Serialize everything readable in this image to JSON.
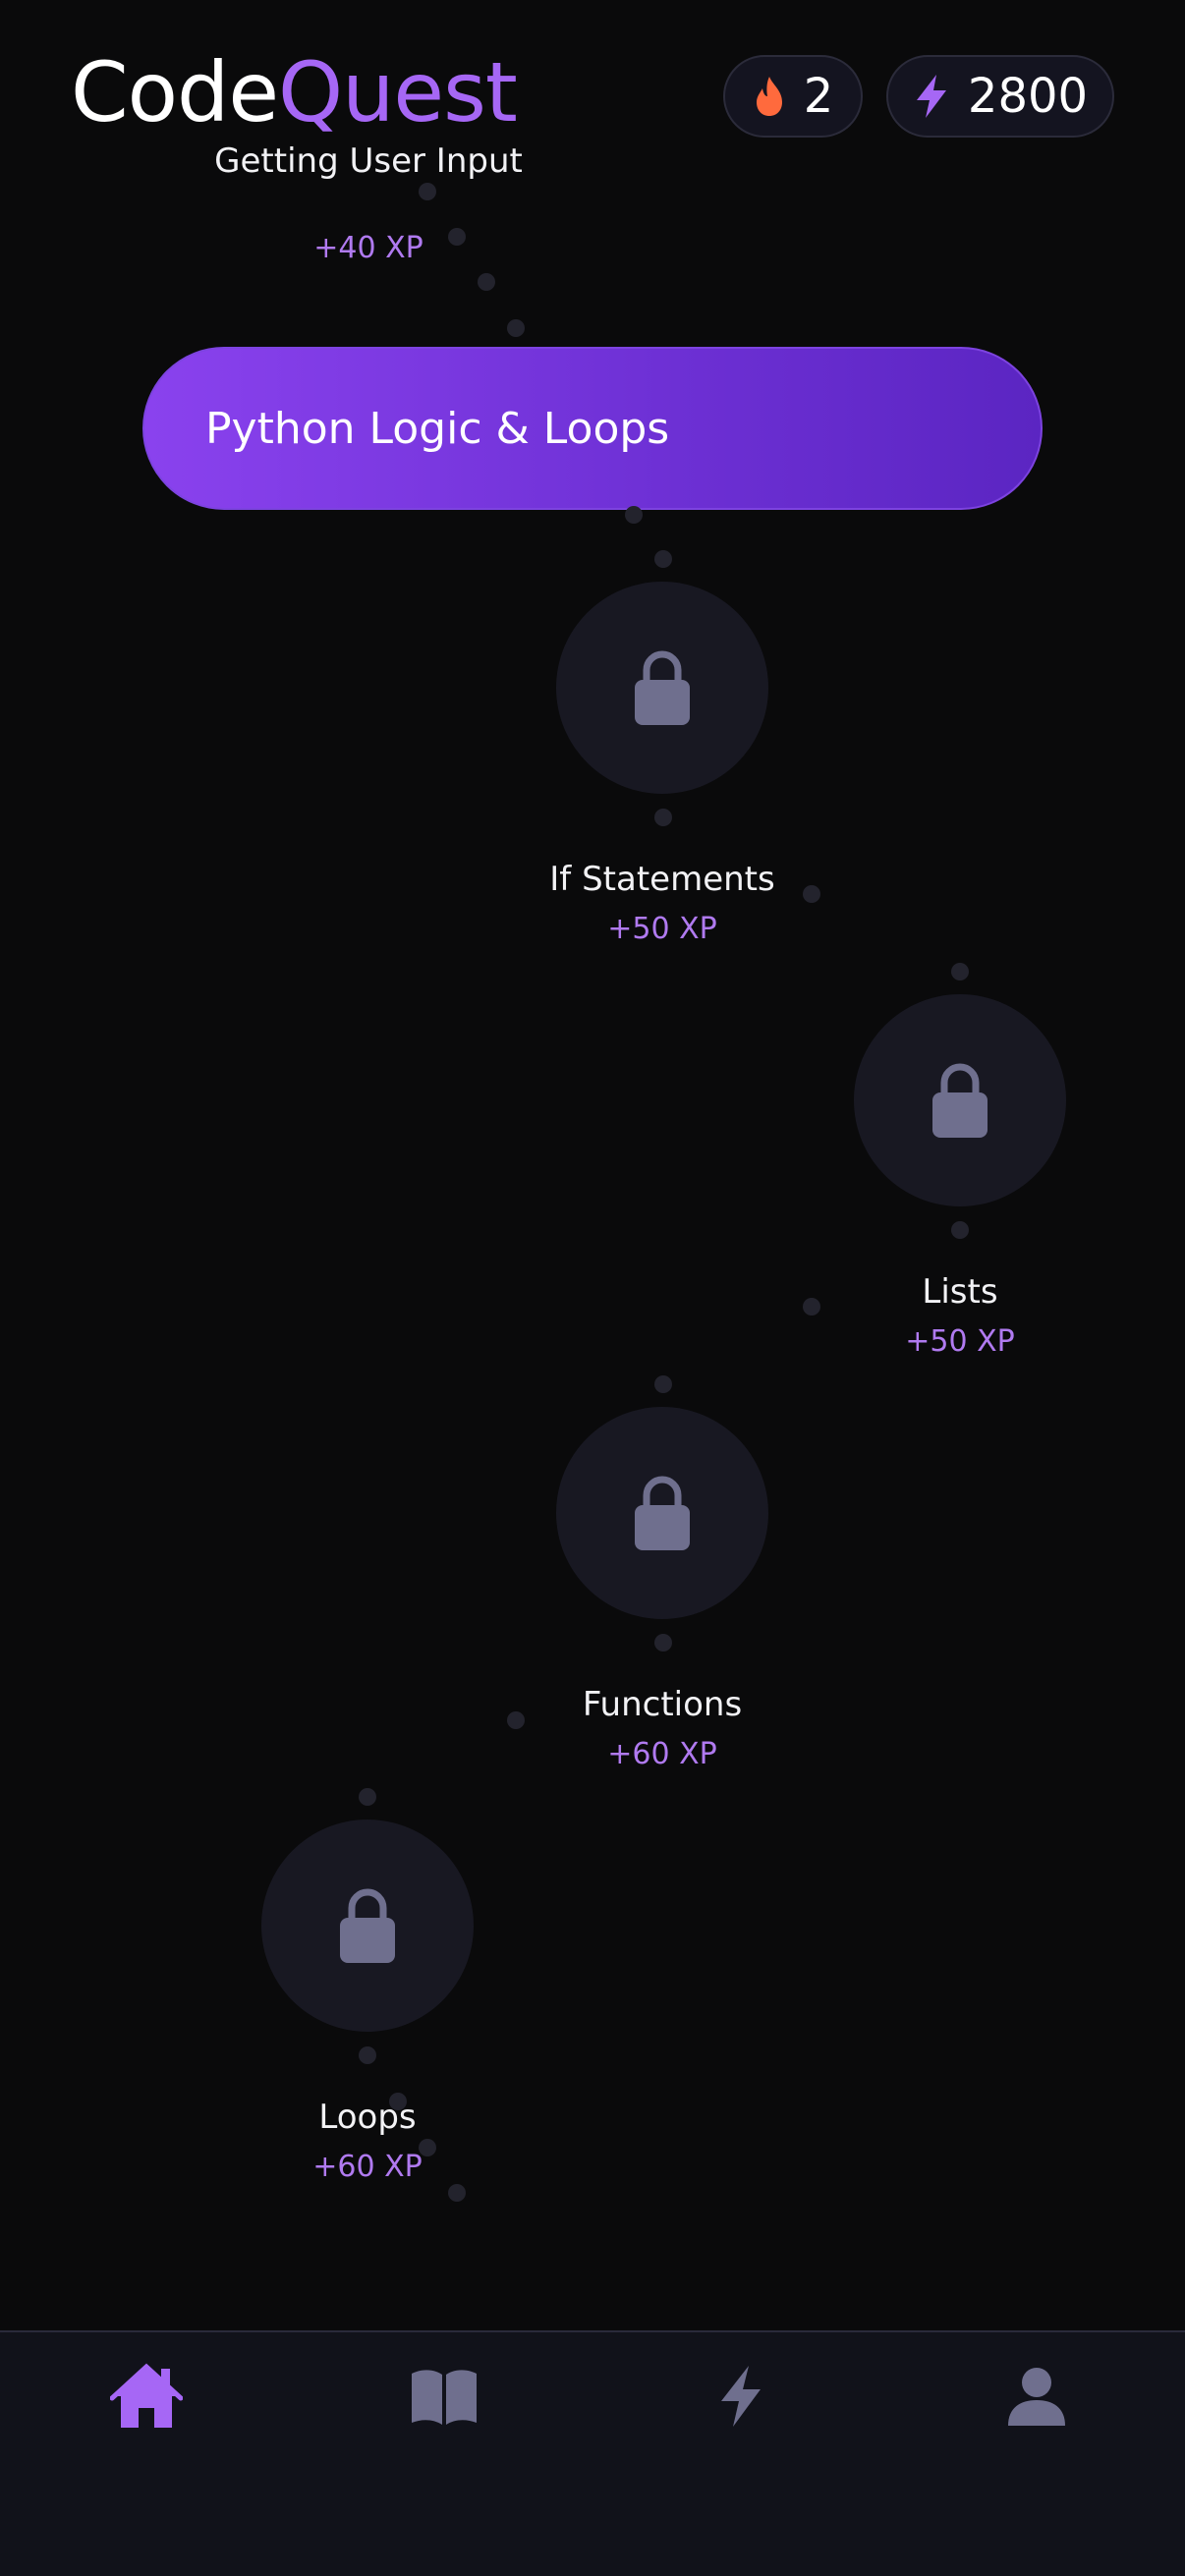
{
  "header": {
    "logo_part1": "Code",
    "logo_part2": "Quest",
    "streak_icon": "flame-icon",
    "streak_value": "2",
    "xp_icon": "lightning-icon",
    "xp_value": "2800"
  },
  "colors": {
    "accent": "#a667f5",
    "streak": "#ff6a3d",
    "locked": "#6f6f8e"
  },
  "path": {
    "previous_lesson": {
      "title": "Getting User Input",
      "xp": "+40 XP"
    },
    "section_banner": "Python Logic & Loops",
    "lessons": [
      {
        "title": "If Statements",
        "xp": "+50 XP",
        "status": "locked",
        "icon": "lock-icon"
      },
      {
        "title": "Lists",
        "xp": "+50 XP",
        "status": "locked",
        "icon": "lock-icon"
      },
      {
        "title": "Functions",
        "xp": "+60 XP",
        "status": "locked",
        "icon": "lock-icon"
      },
      {
        "title": "Loops",
        "xp": "+60 XP",
        "status": "locked",
        "icon": "lock-icon"
      }
    ]
  },
  "nav": {
    "items": [
      {
        "icon": "home-icon",
        "active": true
      },
      {
        "icon": "book-icon",
        "active": false
      },
      {
        "icon": "lightning-icon",
        "active": false
      },
      {
        "icon": "profile-icon",
        "active": false
      }
    ]
  }
}
